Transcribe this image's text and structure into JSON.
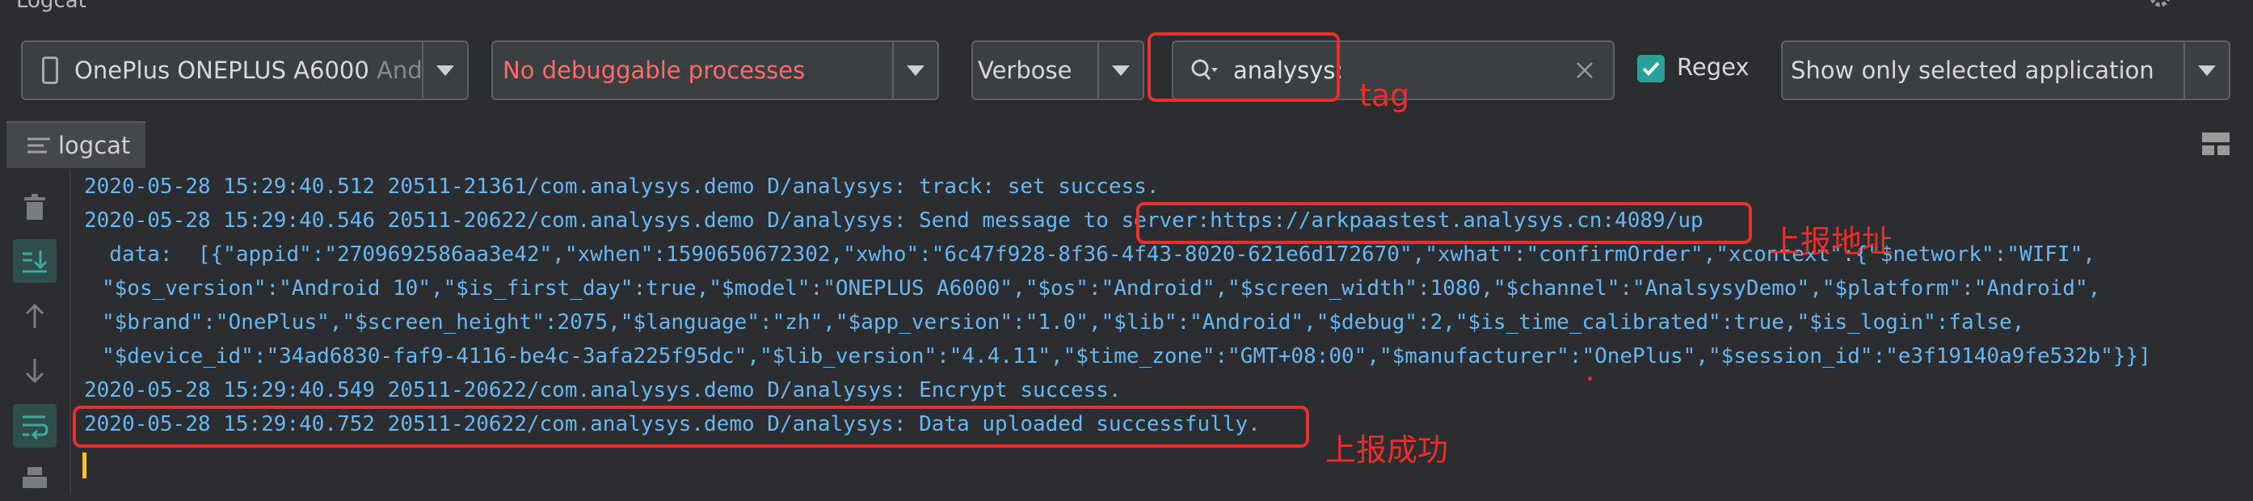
{
  "panel": {
    "title": "Logcat"
  },
  "toolbar": {
    "device": {
      "name": "OnePlus ONEPLUS A6000",
      "suffix": "Andro"
    },
    "process": {
      "label": "No debuggable processes"
    },
    "log_level": {
      "selected": "Verbose"
    },
    "search": {
      "value": "analysys:"
    },
    "regex": {
      "label": "Regex",
      "checked": true
    },
    "filter": {
      "selected": "Show only selected application"
    }
  },
  "tabs": [
    {
      "label": "logcat"
    }
  ],
  "log_lines": [
    "2020-05-28 15:29:40.512 20511-21361/com.analysys.demo D/analysys: track: set success.",
    "2020-05-28 15:29:40.546 20511-20622/com.analysys.demo D/analysys: Send message to server:https://arkpaastest.analysys.cn:4089/up",
    "  data:  [{\"appid\":\"2709692586aa3e42\",\"xwhen\":1590650672302,\"xwho\":\"6c47f928-8f36-4f43-8020-621e6d172670\",\"xwhat\":\"confirmOrder\",\"xcontext\":{\"$network\":\"WIFI\",",
    "\"$os_version\":\"Android 10\",\"$is_first_day\":true,\"$model\":\"ONEPLUS A6000\",\"$os\":\"Android\",\"$screen_width\":1080,\"$channel\":\"AnalsysyDemo\",\"$platform\":\"Android\",",
    "\"$brand\":\"OnePlus\",\"$screen_height\":2075,\"$language\":\"zh\",\"$app_version\":\"1.0\",\"$lib\":\"Android\",\"$debug\":2,\"$is_time_calibrated\":true,\"$is_login\":false,",
    "\"$device_id\":\"34ad6830-faf9-4116-be4c-3afa225f95dc\",\"$lib_version\":\"4.4.11\",\"$time_zone\":\"GMT+08:00\",\"$manufacturer\":\"OnePlus\",\"$session_id\":\"e3f19140a9fe532b\"}}]",
    "2020-05-28 15:29:40.549 20511-20622/com.analysys.demo D/analysys: Encrypt success.",
    "2020-05-28 15:29:40.752 20511-20622/com.analysys.demo D/analysys: Data uploaded successfully."
  ],
  "annotations": {
    "tag_label": "tag",
    "address_label": "上报地址",
    "success_label": "上报成功"
  },
  "colors": {
    "background": "#2b2d30",
    "log_text": "#66b7f2",
    "error_text": "#ff6b68",
    "annotation_red": "#e8302a",
    "checkbox_teal": "#2aa197"
  },
  "icons": [
    "gear-icon",
    "phone-icon",
    "chevron-down-icon",
    "search-icon",
    "clear-icon",
    "check-icon",
    "logcat-tab-icon",
    "layout-icon",
    "trash-icon",
    "scroll-to-end-icon",
    "arrow-up-icon",
    "arrow-down-icon",
    "soft-wrap-icon",
    "print-icon"
  ]
}
